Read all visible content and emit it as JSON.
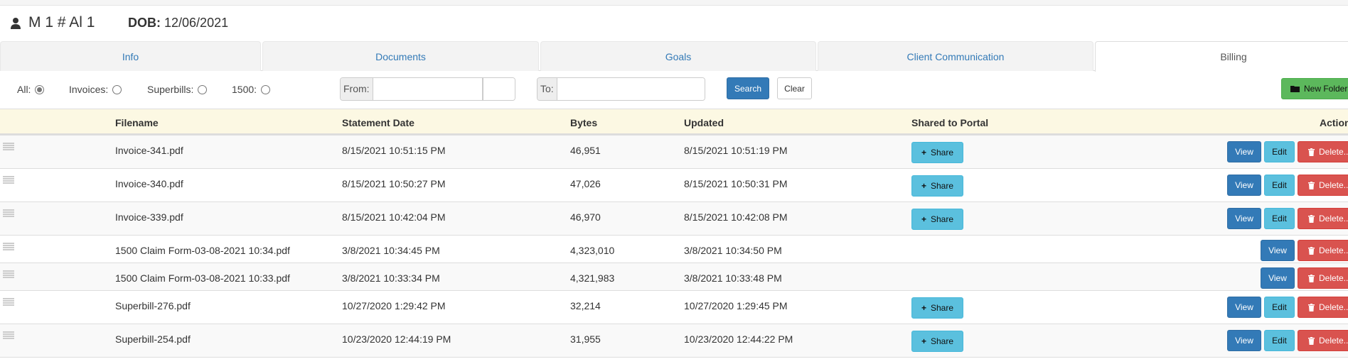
{
  "header": {
    "client_name": "M 1 # Al 1",
    "dob_label": "DOB:",
    "dob_value": "12/06/2021"
  },
  "tabs": [
    {
      "label": "Info"
    },
    {
      "label": "Documents"
    },
    {
      "label": "Goals"
    },
    {
      "label": "Client Communication"
    },
    {
      "label": "Billing",
      "active": true
    }
  ],
  "filters": {
    "all": "All:",
    "invoices": "Invoices:",
    "superbills": "Superbills:",
    "form1500": "1500:",
    "selected": "All",
    "from_label": "From:",
    "from_value": "",
    "to_label": "To:",
    "to_value": "",
    "search": "Search",
    "clear": "Clear",
    "new_folder": "New Folder"
  },
  "table": {
    "columns": [
      "Filename",
      "Statement Date",
      "Bytes",
      "Updated",
      "Shared to Portal",
      "Action"
    ],
    "share_label": "Share",
    "view_label": "View",
    "edit_label": "Edit",
    "delete_label": "Delete...",
    "rows": [
      {
        "filename": "Invoice-341.pdf",
        "statement_date": "8/15/2021 10:51:15 PM",
        "bytes": "46,951",
        "updated": "8/15/2021 10:51:19 PM",
        "share": true,
        "edit": true
      },
      {
        "filename": "Invoice-340.pdf",
        "statement_date": "8/15/2021 10:50:27 PM",
        "bytes": "47,026",
        "updated": "8/15/2021 10:50:31 PM",
        "share": true,
        "edit": true
      },
      {
        "filename": "Invoice-339.pdf",
        "statement_date": "8/15/2021 10:42:04 PM",
        "bytes": "46,970",
        "updated": "8/15/2021 10:42:08 PM",
        "share": true,
        "edit": true
      },
      {
        "filename": "1500 Claim Form-03-08-2021 10:34.pdf",
        "statement_date": "3/8/2021 10:34:45 PM",
        "bytes": "4,323,010",
        "updated": "3/8/2021 10:34:50 PM",
        "share": false,
        "edit": false
      },
      {
        "filename": "1500 Claim Form-03-08-2021 10:33.pdf",
        "statement_date": "3/8/2021 10:33:34 PM",
        "bytes": "4,321,983",
        "updated": "3/8/2021 10:33:48 PM",
        "share": false,
        "edit": false
      },
      {
        "filename": "Superbill-276.pdf",
        "statement_date": "10/27/2020 1:29:42 PM",
        "bytes": "32,214",
        "updated": "10/27/2020 1:29:45 PM",
        "share": true,
        "edit": true
      },
      {
        "filename": "Superbill-254.pdf",
        "statement_date": "10/23/2020 12:44:19 PM",
        "bytes": "31,955",
        "updated": "10/23/2020 12:44:22 PM",
        "share": true,
        "edit": true
      }
    ]
  }
}
